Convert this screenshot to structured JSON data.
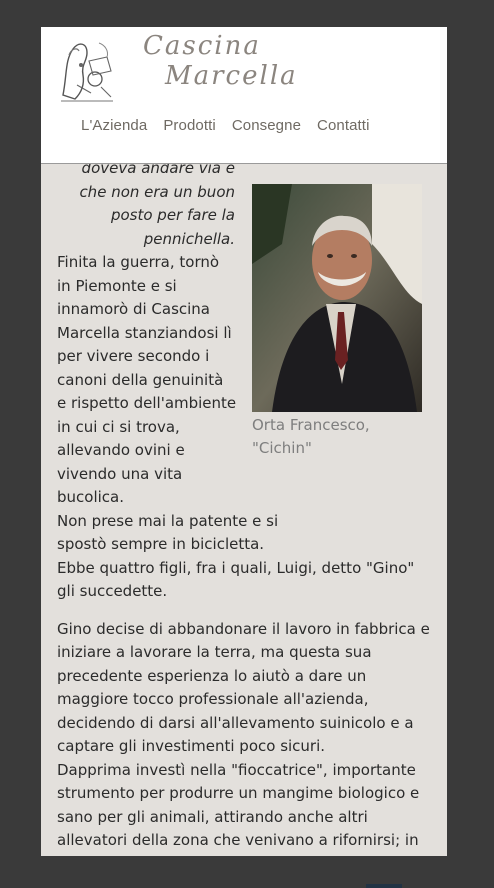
{
  "brand": {
    "name_line1": "Cascina",
    "name_line2": "Marcella"
  },
  "nav": {
    "items": [
      {
        "label": "L'Azienda"
      },
      {
        "label": "Prodotti"
      },
      {
        "label": "Consegne"
      },
      {
        "label": "Contatti"
      }
    ]
  },
  "content": {
    "quote": "doveva andare via e che non era un buon posto per fare la pennichella.",
    "paragraph1": "Finita la guerra, tornò in Piemonte e si innamorò di Cascina Marcella stanziandosi lì per vivere secondo i canoni della genuinità e rispetto dell'ambiente in cui ci si trova, allevando ovini e vivendo una vita bucolica.",
    "paragraph1b": "Non prese mai la patente e si spostò sempre in bicicletta.",
    "paragraph1c": "Ebbe quattro figli, fra i quali, Luigi, detto \"Gino\" gli succedette.",
    "paragraph2": "Gino decise di abbandonare il lavoro in fabbrica e iniziare a lavorare la terra, ma questa sua precedente esperienza lo aiutò a dare un maggiore tocco professionale all'azienda, decidendo di darsi all'allevamento suinicolo e a captare gli investimenti poco sicuri.",
    "paragraph3": "Dapprima investì nella \"fioccatrice\", importante strumento per produrre un mangime biologico e sano per gli animali, attirando anche altri allevatori della zona che venivano a rifornirsi; in secondo luogo iniziò il serviziò di consegna a domicilio, portando i prodotti dalla campagna nella città di"
  },
  "photo": {
    "caption": "Orta Francesco, \"Cichin\""
  }
}
